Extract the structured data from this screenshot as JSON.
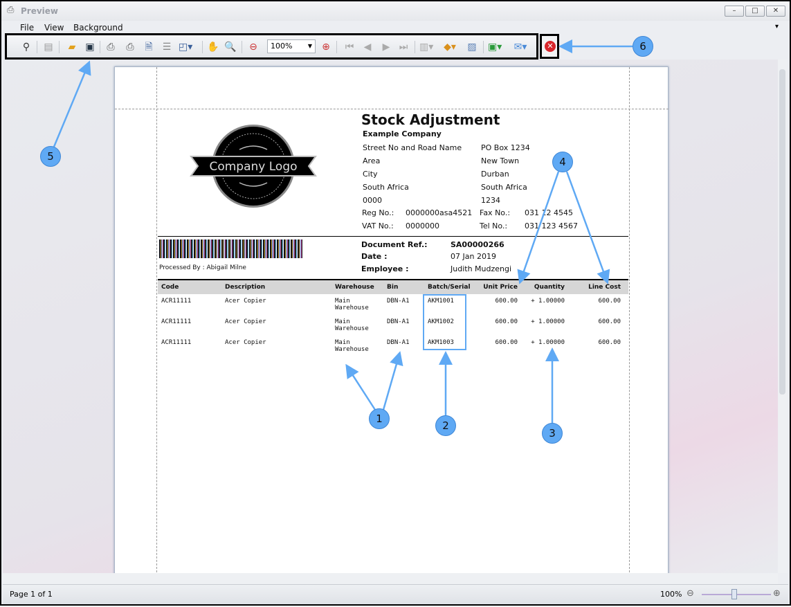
{
  "window": {
    "title": "Preview",
    "controls": [
      "minimize",
      "maximize",
      "close"
    ]
  },
  "menu": [
    "File",
    "View",
    "Background"
  ],
  "toolbar": {
    "icons": [
      "find-icon",
      "thumbnails-icon",
      "open-icon",
      "save-icon",
      "print-dialog-icon",
      "quick-print-icon",
      "page-setup-icon",
      "scale-icon",
      "multiple-pages-icon",
      "hand-tool-icon",
      "magnifier-icon",
      "zoom-out-icon",
      "zoom-in-icon",
      "first-page-icon",
      "previous-page-icon",
      "next-page-icon",
      "last-page-icon",
      "page-layout-icon",
      "page-color-icon",
      "watermark-icon",
      "export-icon",
      "email-icon",
      "close-preview-icon"
    ],
    "zoom": "100%"
  },
  "document": {
    "title": "Stock Adjustment",
    "logo_text": "Company Logo",
    "company": {
      "name": "Example Company",
      "left": [
        "Street No and Road Name",
        "Area",
        "City",
        "South Africa",
        "0000"
      ],
      "right": [
        "PO Box 1234",
        "New Town",
        "Durban",
        "South Africa",
        "1234"
      ],
      "reg_label": "Reg No.:",
      "reg": "0000000asa4521",
      "vat_label": "VAT No.:",
      "vat": "0000000",
      "fax_label": "Fax No.:",
      "fax": "031 12 4545",
      "tel_label": "Tel No.:",
      "tel": "031 123 4567"
    },
    "processed_by": "Processed By : Abigail Milne",
    "doc_ref_label": "Document Ref.:",
    "doc_ref": "SA00000266",
    "date_label": "Date :",
    "date": "07 Jan 2019",
    "employee_label": "Employee :",
    "employee": "Judith Mudzengi",
    "columns": [
      "Code",
      "Description",
      "Warehouse",
      "Bin",
      "Batch/Serial",
      "Unit Price",
      "Quantity",
      "Line Cost"
    ],
    "rows": [
      {
        "code": "ACR11111",
        "desc": "Acer Copier",
        "wh1": "Main",
        "wh2": "Warehouse",
        "bin": "DBN-A1",
        "batch": "AKM1001",
        "price": "600.00",
        "qty": "+ 1.00000",
        "cost": "600.00"
      },
      {
        "code": "ACR11111",
        "desc": "Acer Copier",
        "wh1": "Main",
        "wh2": "Warehouse",
        "bin": "DBN-A1",
        "batch": "AKM1002",
        "price": "600.00",
        "qty": "+ 1.00000",
        "cost": "600.00"
      },
      {
        "code": "ACR11111",
        "desc": "Acer Copier",
        "wh1": "Main",
        "wh2": "Warehouse",
        "bin": "DBN-A1",
        "batch": "AKM1003",
        "price": "600.00",
        "qty": "+ 1.00000",
        "cost": "600.00"
      }
    ]
  },
  "callouts": [
    "1",
    "2",
    "3",
    "4",
    "5",
    "6"
  ],
  "status": {
    "page": "Page 1 of 1",
    "zoom": "100%",
    "zoom_level_percent": 100
  },
  "colors": {
    "callout": "#5fa9f4",
    "highlight": "#000000",
    "close": "#d8262c"
  }
}
